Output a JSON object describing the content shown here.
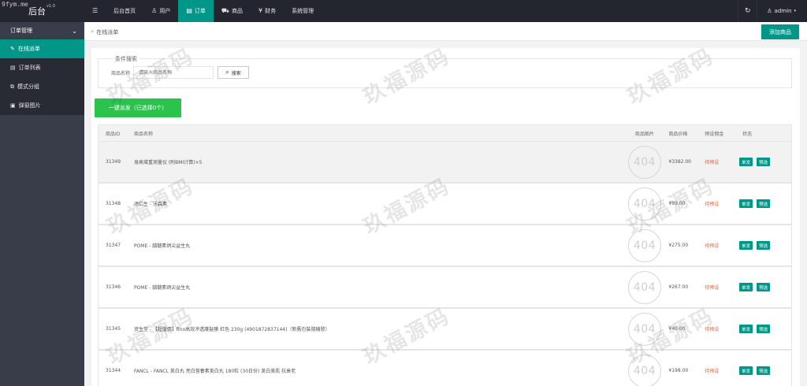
{
  "header": {
    "site_mark": "9fym.me",
    "logo": "后台",
    "version": "v1.0",
    "nav": [
      {
        "label": "后台首页",
        "icon": ""
      },
      {
        "label": "用户",
        "icon": "user-icon"
      },
      {
        "label": "订单",
        "icon": "document-icon",
        "active": true
      },
      {
        "label": "商品",
        "icon": "cart-icon"
      },
      {
        "label": "财务",
        "icon": "yen-icon"
      },
      {
        "label": "系统管理",
        "icon": ""
      }
    ],
    "user": "admin"
  },
  "sidebar": {
    "group": "订单管理",
    "items": [
      {
        "label": "在线派单",
        "icon": "edit-icon",
        "active": true
      },
      {
        "label": "订单列表",
        "icon": "list-icon"
      },
      {
        "label": "模式分组",
        "icon": "group-icon"
      },
      {
        "label": "弹窗图片",
        "icon": "image-icon"
      }
    ]
  },
  "main": {
    "breadcrumb": "在线派单",
    "add_button": "添加商品",
    "filter": {
      "legend": "条件搜索",
      "field_label": "商品名称",
      "placeholder": "请输入商品名称",
      "search_button": "搜索"
    },
    "batch_button": "一键派发（已选择0个）",
    "table": {
      "headers": [
        "商品ID",
        "商品名称",
        "商品图片",
        "商品价格",
        "预设佣金",
        "状态"
      ],
      "rows": [
        {
          "id": "31349",
          "name": "身高增重测量仪 (附BMI计算)×5",
          "img": "404",
          "price": "¥3382.00",
          "fee": "待预设",
          "b1": "单发",
          "b2": "预选"
        },
        {
          "id": "31348",
          "name": "汤仁生 - 沃森素",
          "img": "404",
          "price": "¥99.00",
          "fee": "待预设",
          "b1": "单发",
          "b2": "预选"
        },
        {
          "id": "31347",
          "name": "POME - 龋髓素炳尖益生丸",
          "img": "404",
          "price": "¥275.00",
          "fee": "待预设",
          "b1": "单发",
          "b2": "预选"
        },
        {
          "id": "31346",
          "name": "POME - 龋髓素炳尖益生丸",
          "img": "404",
          "price": "¥267.00",
          "fee": "待预设",
          "b1": "单发",
          "b2": "预选"
        },
        {
          "id": "31345",
          "name": "资生堂 - 【超值價】fino高效滲透護髮膜 紅色 230g (4901872837144)（新舊包裝隨機發）",
          "img": "404",
          "price": "¥40.00",
          "fee": "待预设",
          "b1": "单发",
          "b2": "预选"
        },
        {
          "id": "31344",
          "name": "FANCL - FANCL 美白丸 亮白营養素美白丸 180粒 (30日份) 美白美肌 抗衰老",
          "img": "404",
          "price": "¥198.00",
          "fee": "待预设",
          "b1": "单发",
          "b2": "预选"
        }
      ]
    }
  },
  "watermark": "玖福源码",
  "colors": {
    "accent": "#009688",
    "topbar": "#23262e",
    "sidebar": "#393d49",
    "green": "#2bc34b",
    "pending": "#ff5722"
  }
}
